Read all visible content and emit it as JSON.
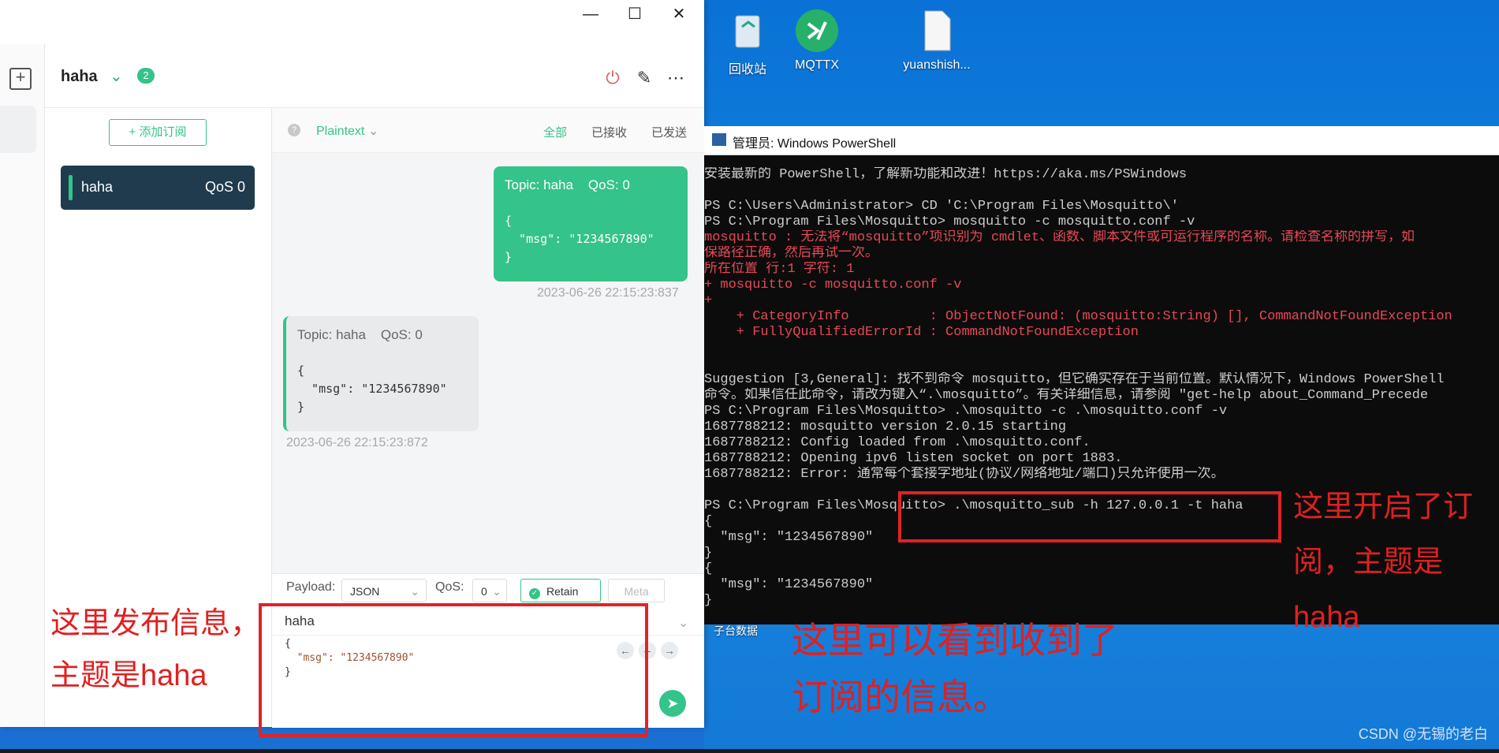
{
  "desktop": {
    "icons": [
      {
        "label": "回收站",
        "icon": "recycle-bin-icon"
      },
      {
        "label": "MQTTX",
        "icon": "mqttx-app-icon"
      },
      {
        "label": "yuanshish...",
        "icon": "document-file-icon"
      },
      {
        "label": "子台数据",
        "icon": "folder-icon"
      }
    ],
    "watermark": "CSDN @无锡的老白"
  },
  "mqttx": {
    "window_buttons": {
      "minimize": "—",
      "maximize": "☐",
      "close": "✕"
    },
    "connection_name": "haha",
    "unread_count": "2",
    "add_subscription": "+ 添加订阅",
    "subscriptions": [
      {
        "topic": "haha",
        "qos": "QoS 0"
      }
    ],
    "format": "Plaintext",
    "filters": [
      "全部",
      "已接收",
      "已发送"
    ],
    "messages": [
      {
        "direction": "sent",
        "topic": "Topic: haha",
        "qos": "QoS: 0",
        "body": "{\n  \"msg\": \"1234567890\"\n}",
        "time": "2023-06-26 22:15:23:837"
      },
      {
        "direction": "received",
        "topic": "Topic: haha",
        "qos": "QoS: 0",
        "body": "{\n  \"msg\": \"1234567890\"\n}",
        "time": "2023-06-26 22:15:23:872"
      }
    ],
    "composer": {
      "payload_label": "Payload:",
      "payload_type": "JSON",
      "qos_label": "QoS:",
      "qos_value": "0",
      "retain": "Retain",
      "meta": "Meta",
      "topic": "haha",
      "payload_lines": [
        "{",
        "  \"msg\": \"1234567890\"",
        "}"
      ]
    }
  },
  "powershell": {
    "title": "管理员: Windows PowerShell",
    "lines": [
      {
        "text": "安装最新的 PowerShell，了解新功能和改进！https://aka.ms/PSWindows",
        "color": "#cccccc"
      },
      {
        "text": "",
        "color": "#cccccc"
      },
      {
        "text": "PS C:\\Users\\Administrator> CD 'C:\\Program Files\\Mosquitto\\'",
        "color": "#cccccc"
      },
      {
        "text": "PS C:\\Program Files\\Mosquitto> mosquitto -c mosquitto.conf -v",
        "color": "#cccccc"
      },
      {
        "text": "mosquitto : 无法将“mosquitto”项识别为 cmdlet、函数、脚本文件或可运行程序的名称。请检查名称的拼写，如",
        "color": "#e74856"
      },
      {
        "text": "保路径正确，然后再试一次。",
        "color": "#e74856"
      },
      {
        "text": "所在位置 行:1 字符: 1",
        "color": "#e74856"
      },
      {
        "text": "+ mosquitto -c mosquitto.conf -v",
        "color": "#e74856"
      },
      {
        "text": "+",
        "color": "#e74856"
      },
      {
        "text": "    + CategoryInfo          : ObjectNotFound: (mosquitto:String) [], CommandNotFoundException",
        "color": "#e74856"
      },
      {
        "text": "    + FullyQualifiedErrorId : CommandNotFoundException",
        "color": "#e74856"
      },
      {
        "text": "",
        "color": "#cccccc"
      },
      {
        "text": "",
        "color": "#cccccc"
      },
      {
        "text": "Suggestion [3,General]: 找不到命令 mosquitto，但它确实存在于当前位置。默认情况下，Windows PowerShell",
        "color": "#cccccc"
      },
      {
        "text": "命令。如果信任此命令，请改为键入“.\\mosquitto”。有关详细信息，请参阅 \"get-help about_Command_Precede",
        "color": "#cccccc"
      },
      {
        "text": "PS C:\\Program Files\\Mosquitto> .\\mosquitto -c .\\mosquitto.conf -v",
        "color": "#cccccc"
      },
      {
        "text": "1687788212: mosquitto version 2.0.15 starting",
        "color": "#cccccc"
      },
      {
        "text": "1687788212: Config loaded from .\\mosquitto.conf.",
        "color": "#cccccc"
      },
      {
        "text": "1687788212: Opening ipv6 listen socket on port 1883.",
        "color": "#cccccc"
      },
      {
        "text": "1687788212: Error: 通常每个套接字地址(协议/网络地址/端口)只允许使用一次。",
        "color": "#cccccc"
      },
      {
        "text": "",
        "color": "#cccccc"
      },
      {
        "text": "PS C:\\Program Files\\Mosquitto> .\\mosquitto_sub -h 127.0.0.1 -t haha",
        "color": "#cccccc"
      },
      {
        "text": "{",
        "color": "#cccccc"
      },
      {
        "text": "  \"msg\": \"1234567890\"",
        "color": "#cccccc"
      },
      {
        "text": "}",
        "color": "#cccccc"
      },
      {
        "text": "{",
        "color": "#cccccc"
      },
      {
        "text": "  \"msg\": \"1234567890\"",
        "color": "#cccccc"
      },
      {
        "text": "}",
        "color": "#cccccc"
      }
    ]
  },
  "annotations": {
    "publish_note": "这里发布信息，\n主题是haha",
    "subscribe_note": "这里开启了订\n阅，主题是\nhaha",
    "received_note": "这里可以看到收到了\n订阅的信息。"
  },
  "colors": {
    "accent": "#34c388",
    "annotation": "#e22227",
    "ps_error": "#e74856"
  }
}
